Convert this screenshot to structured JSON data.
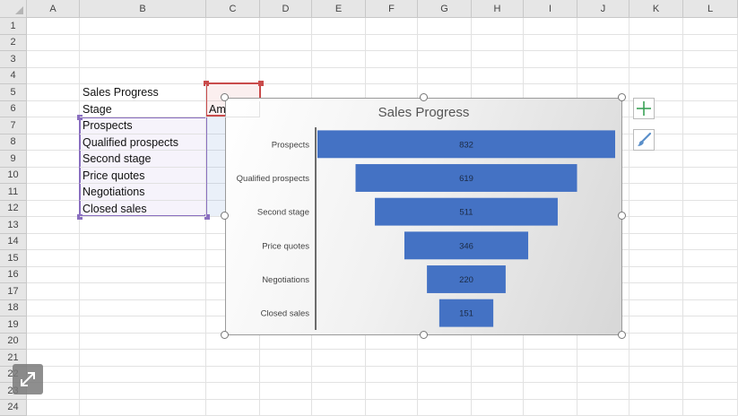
{
  "columns": [
    "A",
    "B",
    "C",
    "D",
    "E",
    "F",
    "G",
    "H",
    "I",
    "J",
    "K",
    "L"
  ],
  "rows": [
    "1",
    "2",
    "3",
    "4",
    "5",
    "6",
    "7",
    "8",
    "9",
    "10",
    "11",
    "12",
    "13",
    "14",
    "15",
    "16",
    "17",
    "18",
    "19",
    "20",
    "21",
    "22",
    "23",
    "24"
  ],
  "sheet": {
    "title_cell": "Sales Progress",
    "header_stage": "Stage",
    "header_amount_partial": "Am",
    "stages": [
      "Prospects",
      "Qualified prospects",
      "Second stage",
      "Price quotes",
      "Negotiations",
      "Closed sales"
    ]
  },
  "chart_data": {
    "type": "bar",
    "title": "Sales Progress",
    "categories": [
      "Prospects",
      "Qualified prospects",
      "Second stage",
      "Price quotes",
      "Negotiations",
      "Closed sales"
    ],
    "values": [
      832,
      619,
      511,
      346,
      220,
      151
    ],
    "style": "funnel",
    "bar_color": "#4472c4",
    "legend": "none",
    "grid": false
  },
  "icons": {
    "chart_elements": "plus-icon",
    "chart_styles": "brush-icon",
    "expand": "expand-arrows-icon"
  },
  "colors": {
    "selection_purple": "#8a6fc0",
    "selection_red": "#c94b4b",
    "plus_green": "#3aa157",
    "bar_blue": "#4472c4"
  }
}
